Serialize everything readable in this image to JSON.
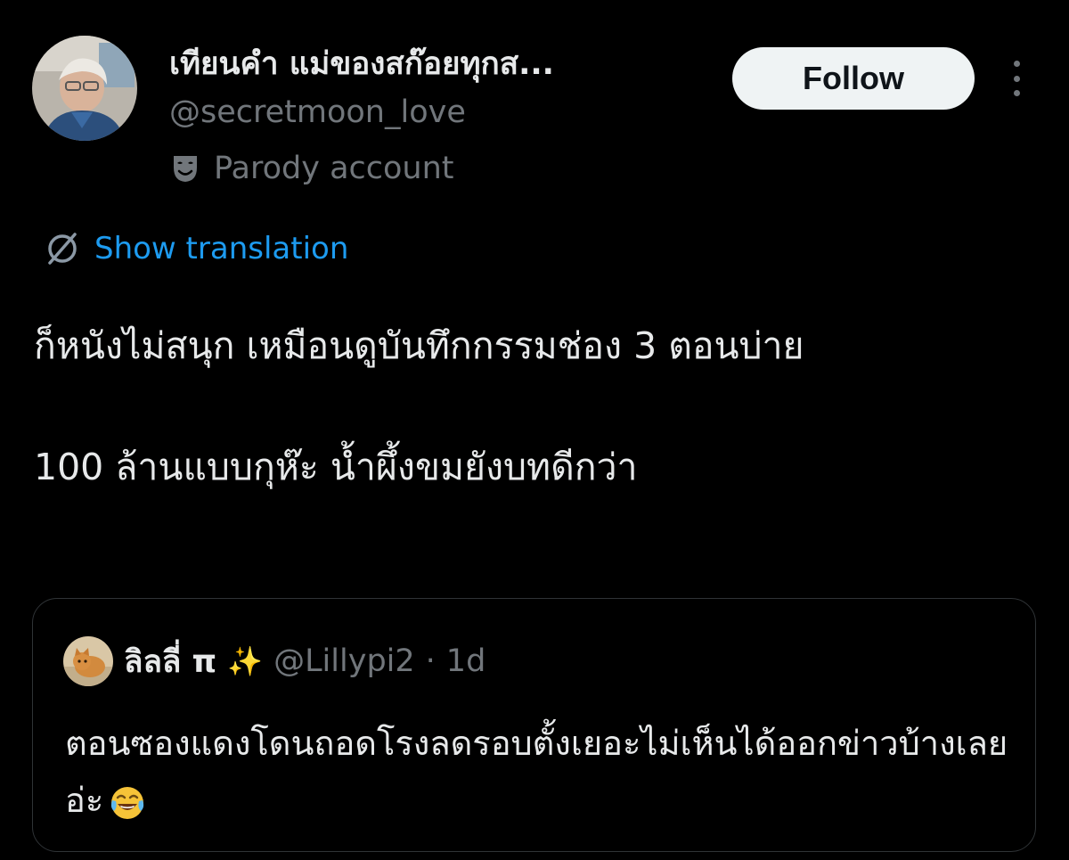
{
  "author": {
    "display_name": "เทียนคำ แม่ของสก๊อยทุกส...",
    "handle": "@secretmoon_love",
    "badge_label": "Parody account",
    "badge_icon": "theater-mask-icon",
    "avatar_icon": "profile-photo"
  },
  "actions": {
    "follow_label": "Follow",
    "more_icon": "more-vertical-icon"
  },
  "translation": {
    "label": "Show translation",
    "icon": "globe-icon"
  },
  "tweet": {
    "line1": "ก็หนังไม่สนุก เหมือนดูบันทึกกรรมช่อง 3 ตอนบ่าย",
    "line2": "100 ล้านแบบกุห๊ะ น้ำผึ้งขมยังบทดีกว่า"
  },
  "quoted": {
    "name": "ลิลลี่ π",
    "sparkle": "✨",
    "handle": "@Lillypi2",
    "separator": "·",
    "time": "1d",
    "text": "ตอนซองแดงโดนถอดโรงลดรอบตั้งเยอะไม่เห็นได้ออกข่าวบ้างเลยอ่ะ",
    "emoji": "laughing-tears-emoji"
  },
  "colors": {
    "background": "#000000",
    "text_primary": "#e7e9ea",
    "text_secondary": "#71767b",
    "link": "#1d9bf0",
    "button_bg": "#eff3f4",
    "button_text": "#0f1419",
    "border": "#2f3336"
  }
}
